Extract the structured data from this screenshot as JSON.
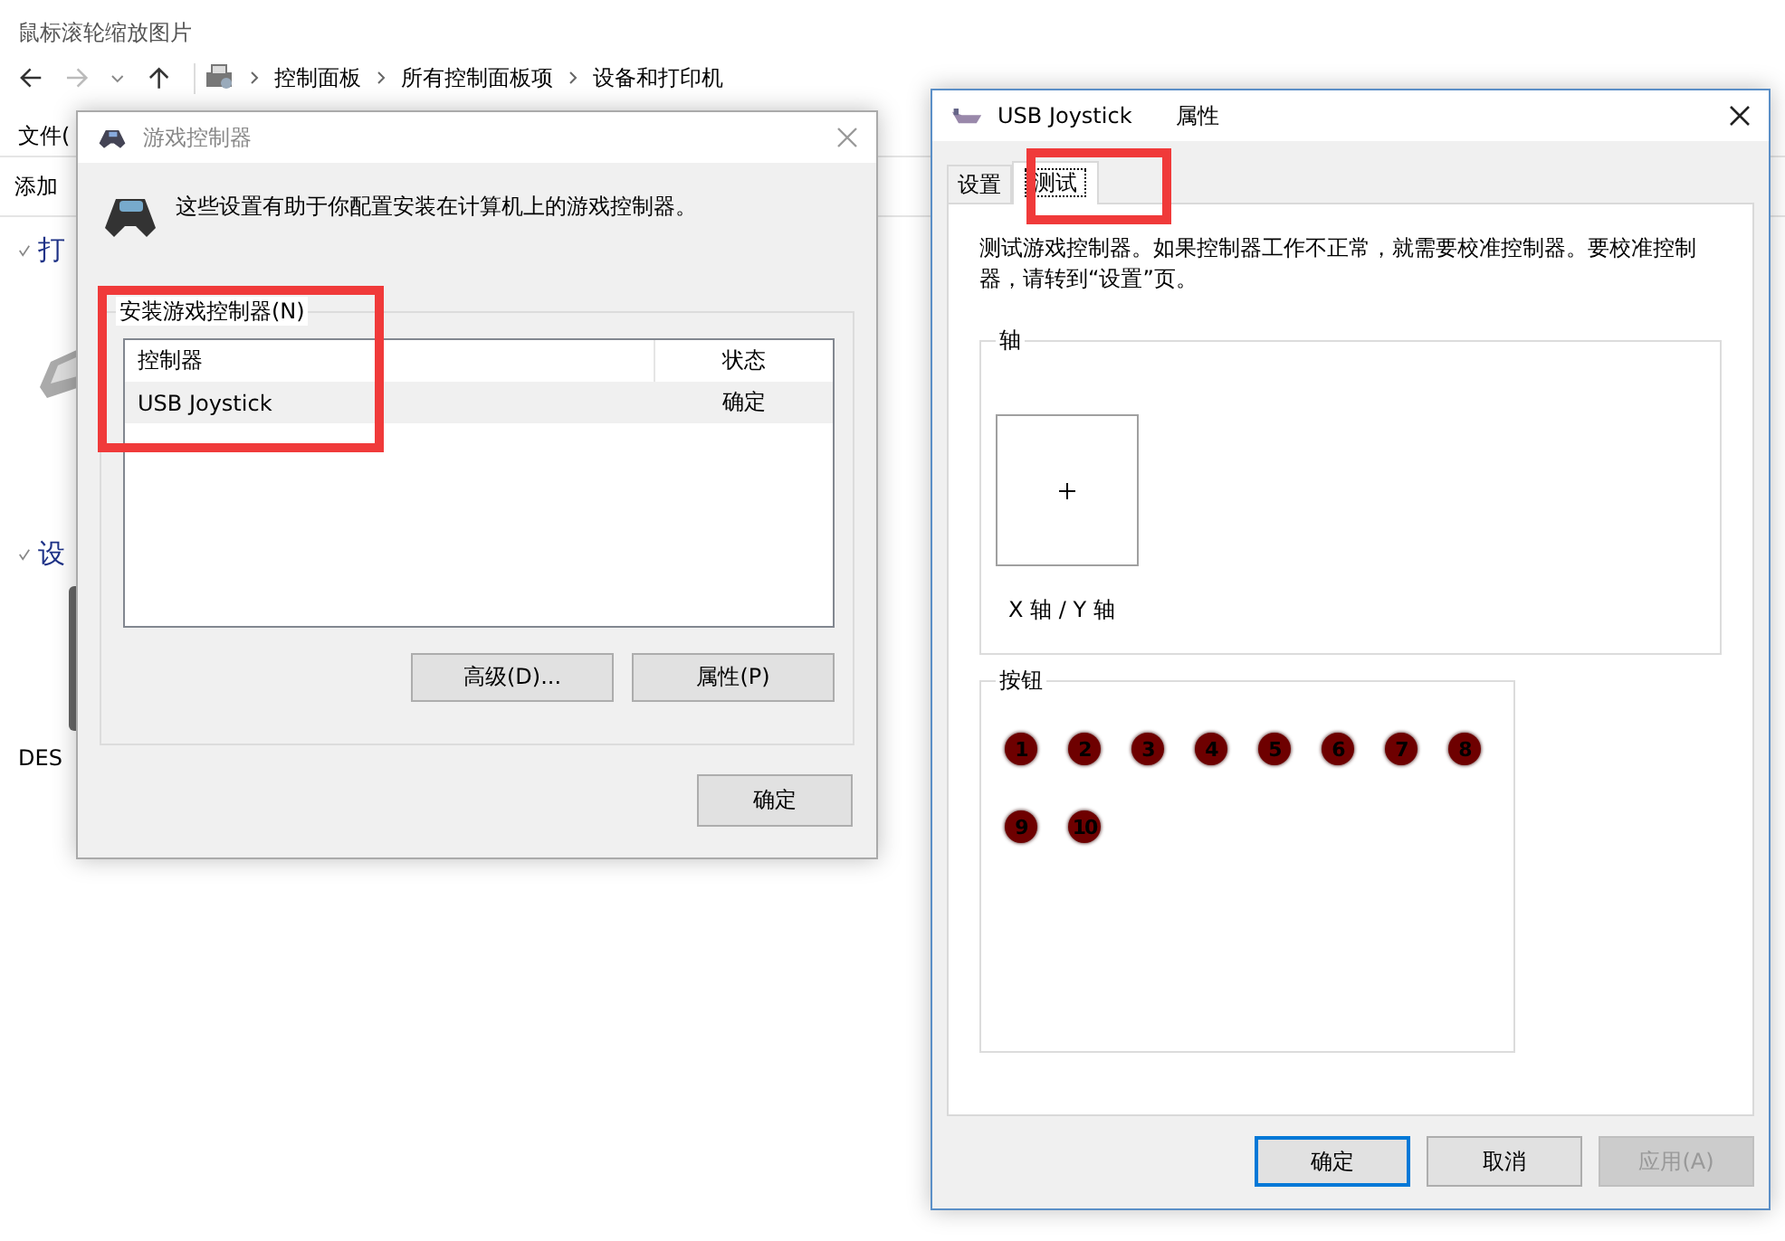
{
  "explorer": {
    "title": "鼠标滚轮缩放图片",
    "breadcrumbs": [
      "控制面板",
      "所有控制面板项",
      "设备和打印机"
    ],
    "menu": "文件(",
    "toolbar": "添加",
    "sections": [
      "打",
      "设"
    ],
    "device_label": "DES"
  },
  "game_controllers": {
    "title": "游戏控制器",
    "intro": "这些设置有助于你配置安装在计算机上的游戏控制器。",
    "group": "安装游戏控制器(N)",
    "columns": [
      "控制器",
      "状态"
    ],
    "rows": [
      {
        "name": "USB Joystick",
        "status": "确定",
        "selected": true
      }
    ],
    "buttons": [
      "高级(D)...",
      "属性(P)"
    ],
    "ok": "确定"
  },
  "properties": {
    "title": "USB Joystick",
    "title_suffix": "属性",
    "tabs": [
      {
        "label": "设置",
        "selected": false
      },
      {
        "label": "测试",
        "selected": true
      }
    ],
    "description": "测试游戏控制器。如果控制器工作不正常，就需要校准控制器。要校准控制器，请转到“设置”页。",
    "axes_group": "轴",
    "axes_label": "X 轴 / Y 轴",
    "buttons_group": "按钮",
    "joystick_buttons": [
      "1",
      "2",
      "3",
      "4",
      "5",
      "6",
      "7",
      "8",
      "9",
      "10"
    ],
    "dialog_buttons": [
      {
        "label": "确定",
        "default": true,
        "disabled": false
      },
      {
        "label": "取消",
        "default": false,
        "disabled": false
      },
      {
        "label": "应用(A)",
        "default": false,
        "disabled": true
      }
    ]
  }
}
